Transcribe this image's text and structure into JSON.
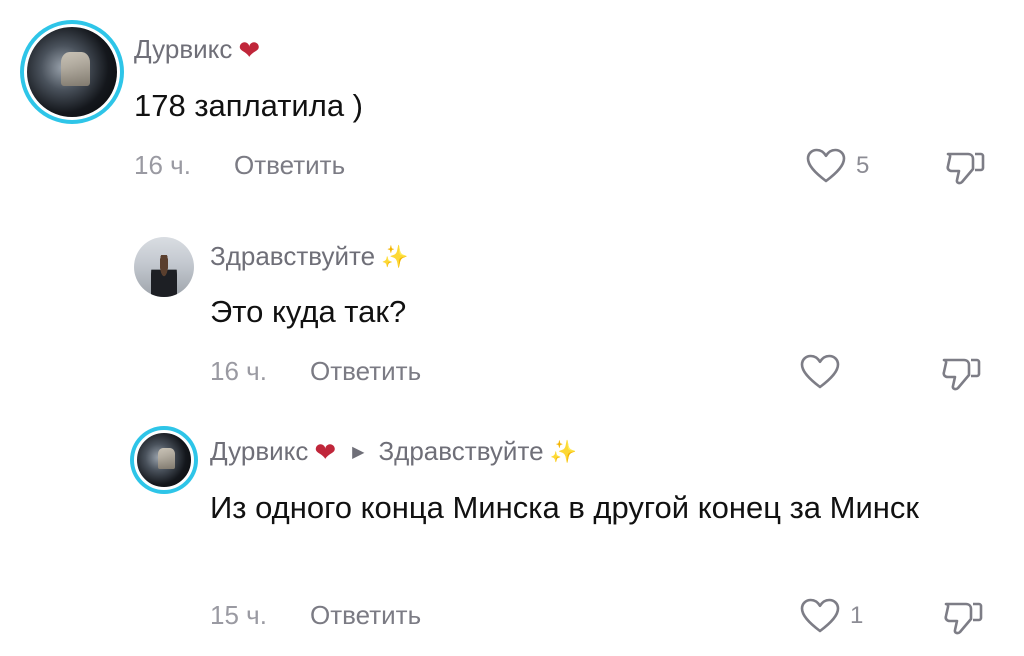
{
  "comments": [
    {
      "username": "Дурвикс",
      "username_emoji": "❤",
      "text": "178 заплатила )",
      "time": "16 ч.",
      "reply_label": "Ответить",
      "likes": "5"
    },
    {
      "username": "Здравствуйте",
      "username_emoji": "✨",
      "text": "Это куда так?",
      "time": "16 ч.",
      "reply_label": "Ответить",
      "likes": ""
    },
    {
      "username": "Дурвикс",
      "username_emoji": "❤",
      "reply_to": "Здравствуйте",
      "reply_to_emoji": "✨",
      "text": "Из одного конца Минска в другой конец за Минск",
      "time": "15 ч.",
      "reply_label": "Ответить",
      "likes": "1"
    }
  ],
  "icons": {
    "like": "heart-outline-icon",
    "dislike": "thumbs-down-icon",
    "reply_arrow": "triangle-right-icon"
  },
  "colors": {
    "avatar_ring": "#2ec5e8",
    "meta_text": "#9a9aa2",
    "username": "#6f6f78"
  }
}
